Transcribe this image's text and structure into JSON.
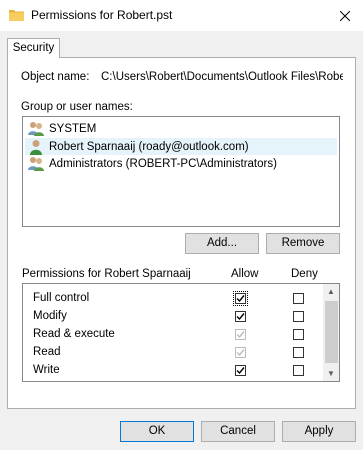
{
  "window": {
    "title": "Permissions for Robert.pst",
    "close_label": "✕"
  },
  "tabs": [
    {
      "label": "Security",
      "selected": true
    }
  ],
  "object_name": {
    "label": "Object name:",
    "value": "C:\\Users\\Robert\\Documents\\Outlook Files\\Robert.pst"
  },
  "group_users": {
    "label": "Group or user names:",
    "items": [
      {
        "name": "SYSTEM",
        "icon": "users-group-icon",
        "selected": false
      },
      {
        "name": "Robert Sparnaaij (roady@outlook.com)",
        "icon": "user-icon",
        "selected": true
      },
      {
        "name": "Administrators (ROBERT-PC\\Administrators)",
        "icon": "users-group-icon",
        "selected": false
      }
    ]
  },
  "buttons": {
    "add": "Add...",
    "remove": "Remove",
    "ok": "OK",
    "cancel": "Cancel",
    "apply": "Apply"
  },
  "permissions": {
    "header": "Permissions for Robert Sparnaaij",
    "allow_label": "Allow",
    "deny_label": "Deny",
    "rows": [
      {
        "name": "Full control",
        "allow": true,
        "allow_disabled": false,
        "deny": false
      },
      {
        "name": "Modify",
        "allow": true,
        "allow_disabled": false,
        "deny": false
      },
      {
        "name": "Read & execute",
        "allow": true,
        "allow_disabled": true,
        "deny": false
      },
      {
        "name": "Read",
        "allow": true,
        "allow_disabled": true,
        "deny": false
      },
      {
        "name": "Write",
        "allow": true,
        "allow_disabled": false,
        "deny": false
      }
    ]
  },
  "colors": {
    "selection": "#e5f3fb",
    "folder": "#f4c556",
    "user_green": "#3a8f3a"
  }
}
